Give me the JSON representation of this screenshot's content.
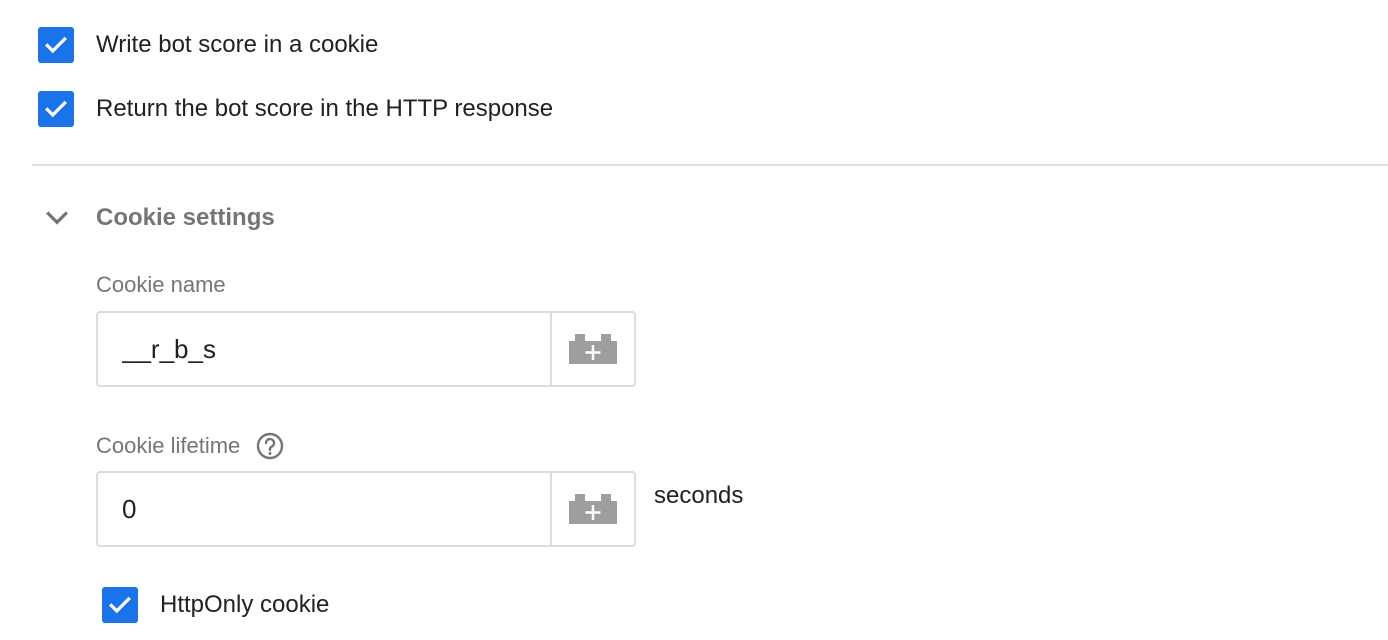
{
  "options": {
    "write_cookie": {
      "label": "Write bot score in a cookie",
      "checked": true
    },
    "return_http": {
      "label": "Return the bot score in the HTTP response",
      "checked": true
    }
  },
  "cookie_settings": {
    "title": "Cookie settings",
    "expanded": true,
    "name_field": {
      "label": "Cookie name",
      "value": "__r_b_s"
    },
    "lifetime_field": {
      "label": "Cookie lifetime",
      "value": "0",
      "suffix": "seconds"
    },
    "http_only": {
      "label": "HttpOnly cookie",
      "checked": true
    }
  },
  "icons": {
    "checkbox": "check-icon",
    "section_toggle": "chevron-down-icon",
    "help": "help-circle-icon",
    "variable_picker": "add-variable-brick-icon"
  },
  "colors": {
    "accent": "#1a73e8",
    "muted_text": "#757575",
    "border": "#dadce0",
    "icon_gray": "#9e9e9e"
  }
}
